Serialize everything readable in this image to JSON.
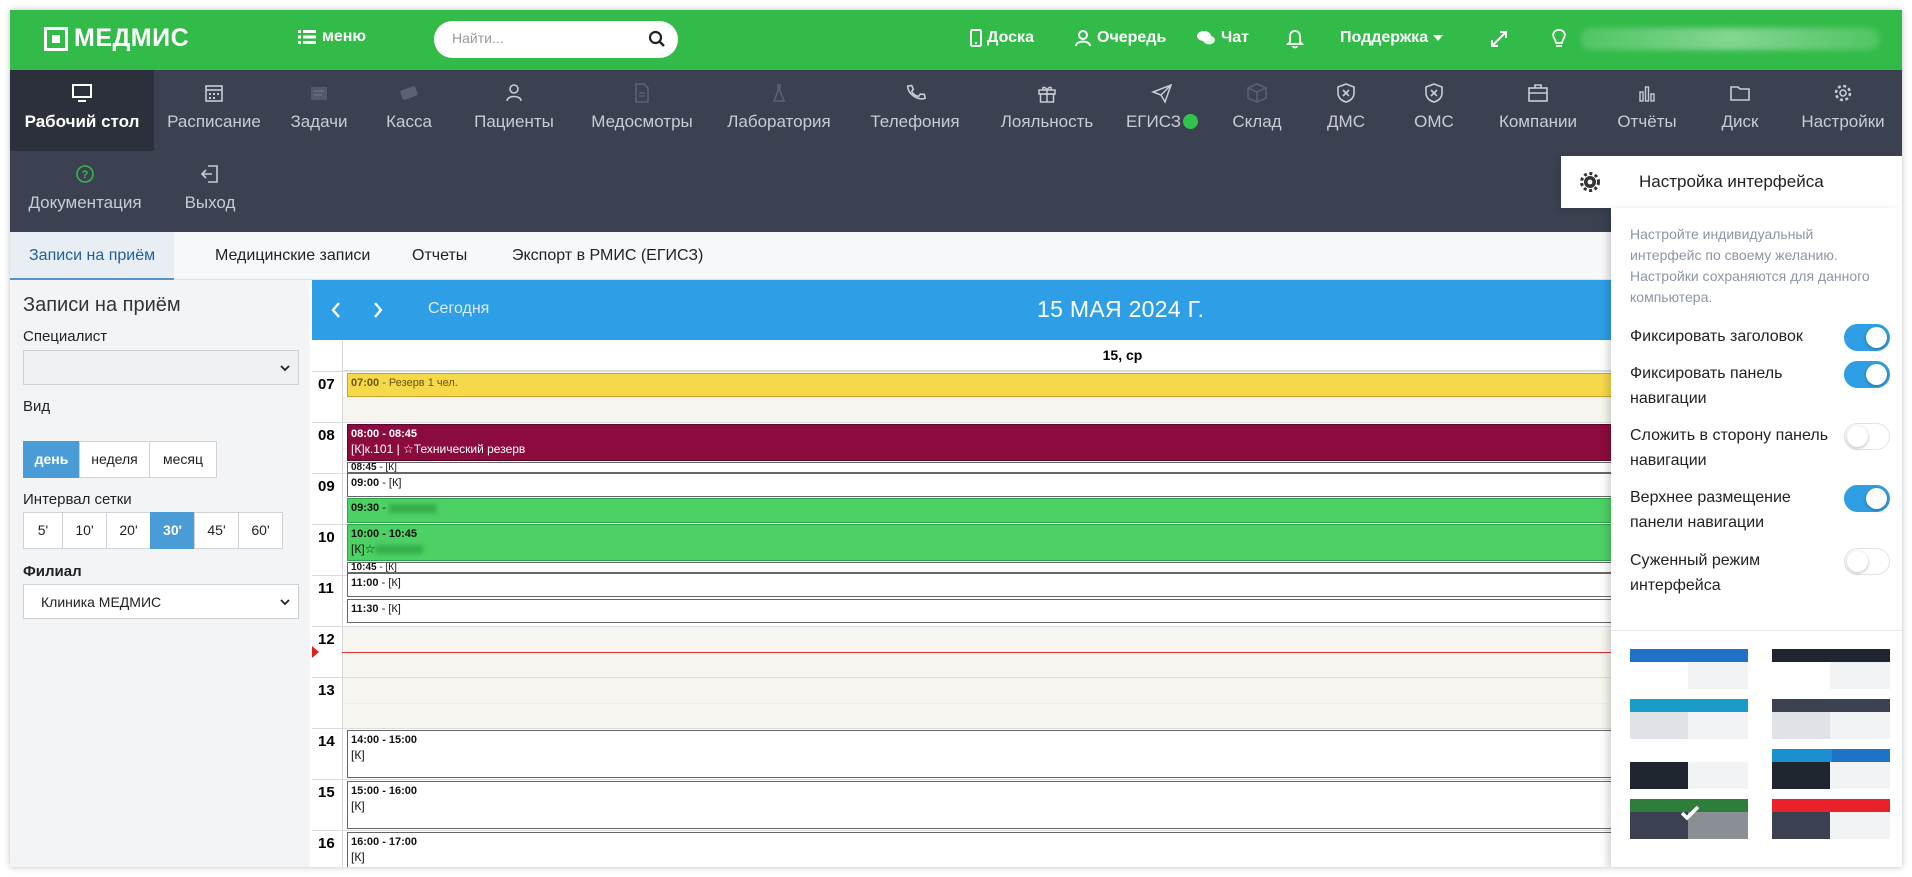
{
  "app": {
    "logo_text": "МЕДМИС",
    "menu_label": "меню"
  },
  "search": {
    "placeholder": "Найти..."
  },
  "topbar": {
    "links": {
      "board": "Доска",
      "queue": "Очередь",
      "chat": "Чат",
      "support": "Поддержка"
    }
  },
  "nav": {
    "items": [
      {
        "label": "Рабочий стол",
        "icon": "monitor-icon"
      },
      {
        "label": "Расписание",
        "icon": "calendar-icon"
      },
      {
        "label": "Задачи",
        "icon": "tasks-icon"
      },
      {
        "label": "Касса",
        "icon": "cash-icon"
      },
      {
        "label": "Пациенты",
        "icon": "patient-icon"
      },
      {
        "label": "Медосмотры",
        "icon": "document-icon"
      },
      {
        "label": "Лаборатория",
        "icon": "flask-icon"
      },
      {
        "label": "Телефония",
        "icon": "phone-icon"
      },
      {
        "label": "Лояльность",
        "icon": "gift-icon"
      },
      {
        "label": "ЕГИСЗ",
        "icon": "paper-plane-icon"
      },
      {
        "label": "Склад",
        "icon": "box-icon"
      },
      {
        "label": "ДМС",
        "icon": "shield-icon"
      },
      {
        "label": "ОМС",
        "icon": "shield-icon"
      },
      {
        "label": "Компании",
        "icon": "briefcase-icon"
      },
      {
        "label": "Отчёты",
        "icon": "bar-chart-icon"
      },
      {
        "label": "Диск",
        "icon": "folder-icon"
      },
      {
        "label": "Настройки",
        "icon": "gear-icon"
      },
      {
        "label": "Документация",
        "icon": "help-icon"
      },
      {
        "label": "Выход",
        "icon": "logout-icon"
      }
    ]
  },
  "tabs": [
    {
      "label": "Записи на приём",
      "active": true
    },
    {
      "label": "Медицинские записи",
      "active": false
    },
    {
      "label": "Отчеты",
      "active": false
    },
    {
      "label": "Экспорт в РМИС (ЕГИСЗ)",
      "active": false
    }
  ],
  "sidebar": {
    "title": "Записи на приём",
    "specialist_label": "Специалист",
    "specialist_value": "",
    "view_label": "Вид",
    "views": [
      "день",
      "неделя",
      "месяц"
    ],
    "view_active": "день",
    "interval_label": "Интервал сетки",
    "intervals": [
      "5'",
      "10'",
      "20'",
      "30'",
      "45'",
      "60'"
    ],
    "interval_active": "30'",
    "branch_label": "Филиал",
    "branch_value": "Клиника МЕДМИС"
  },
  "calendar": {
    "today_label": "Сегодня",
    "title": "15 МАЯ 2024 Г.",
    "day_header": "15, ср",
    "hours": [
      "07",
      "08",
      "09",
      "10",
      "11",
      "12",
      "13",
      "14",
      "15",
      "16"
    ],
    "events": [
      {
        "time": "07:00",
        "text": "Резерв 1 чел.",
        "style": "yellow"
      },
      {
        "time": "08:00 - 08:45",
        "text": "[К]к.101 | ☆Технический резерв",
        "style": "maroon"
      },
      {
        "time": "08:45",
        "text": "[К]",
        "style": "white"
      },
      {
        "time": "09:00",
        "text": "[К]",
        "style": "white"
      },
      {
        "time": "09:30",
        "text": "",
        "style": "green"
      },
      {
        "time": "10:00 - 10:45",
        "text": "[К]☆",
        "style": "green"
      },
      {
        "time": "10:45",
        "text": "[К]",
        "style": "white"
      },
      {
        "time": "11:00",
        "text": "[К]",
        "style": "white"
      },
      {
        "time": "11:30",
        "text": "[К]",
        "style": "white"
      },
      {
        "time": "14:00 - 15:00",
        "text": "[К]",
        "style": "white"
      },
      {
        "time": "15:00 - 16:00",
        "text": "[К]",
        "style": "white"
      },
      {
        "time": "16:00 - 17:00",
        "text": "[К]",
        "style": "white"
      }
    ]
  },
  "settings_panel": {
    "title": "Настройка интерфейса",
    "description": "Настройте индивидуальный интерфейс по своему желанию. Настройки сохраняются для данного компьютера.",
    "options": [
      {
        "label": "Фиксировать заголовок",
        "on": true
      },
      {
        "label": "Фиксировать панель навигации",
        "on": true
      },
      {
        "label": "Сложить в сторону панель навигации",
        "on": false
      },
      {
        "label": "Верхнее размещение панели навигации",
        "on": true
      },
      {
        "label": "Суженный режим интерфейса",
        "on": false
      }
    ],
    "themes": [
      {
        "header": "#1e73c9",
        "sidebar": "#ffffff",
        "selected": false
      },
      {
        "header": "#1f2630",
        "sidebar": "#ffffff",
        "selected": false
      },
      {
        "header": "#1a9ccb",
        "sidebar": "#dfe3e7",
        "selected": false
      },
      {
        "header": "#3b4151",
        "sidebar": "#dfe3e7",
        "selected": false
      },
      {
        "header": "#ffffff",
        "sidebar": "#1f2630",
        "selected": false
      },
      {
        "header": "#1a8fd0",
        "sidebar": "#1f2630",
        "selected": false
      },
      {
        "header": "#2e7d3b",
        "sidebar": "#3b4151",
        "selected": true
      },
      {
        "header": "#e8212a",
        "sidebar": "#3b4151",
        "selected": false
      }
    ]
  },
  "colors": {
    "brand_green": "#32bb48",
    "nav_bg": "#3b4151",
    "calendar_header": "#2e9fe6",
    "toggle_on": "#2f9ee4"
  }
}
